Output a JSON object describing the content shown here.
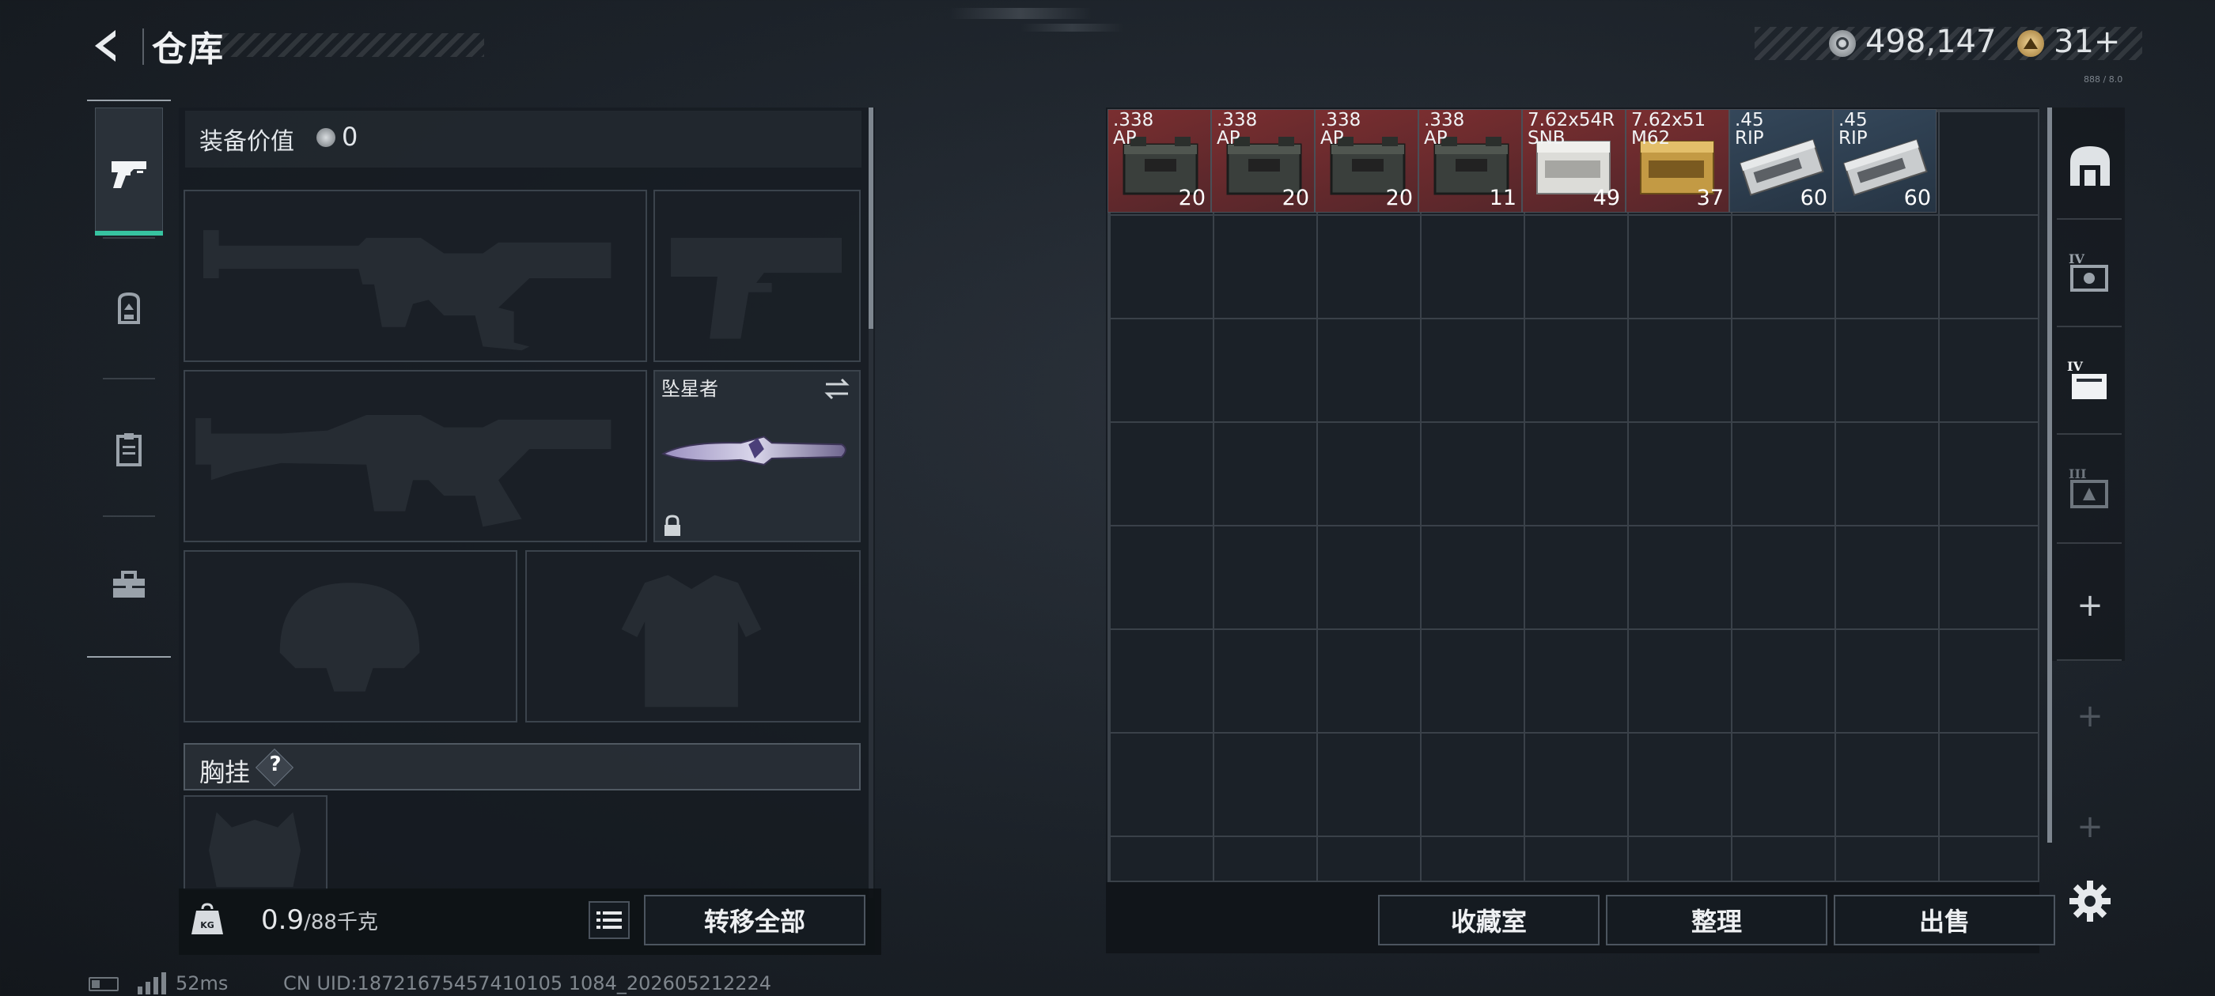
{
  "header": {
    "title": "仓库",
    "currency_primary": "498,147",
    "currency_secondary": "31",
    "currency_secondary_add": "+",
    "version_tag": "888 / 8.0",
    "back_icon": "chevron-left-icon"
  },
  "left_tabs": [
    {
      "name": "weapons",
      "icon": "pistol-icon",
      "active": true
    },
    {
      "name": "backpack",
      "icon": "backpack-icon",
      "active": false
    },
    {
      "name": "clipboard",
      "icon": "clipboard-icon",
      "active": false
    },
    {
      "name": "toolbox",
      "icon": "toolbox-icon",
      "active": false
    }
  ],
  "equipment": {
    "value_label": "装备价值",
    "value": "0",
    "melee_name": "坠星者",
    "chest_rig_label": "胸挂",
    "chest_rig_help": "?",
    "weight_value": "0.9",
    "weight_capacity": "/88千克",
    "kg_badge": "KG",
    "transfer_all_label": "转移全部"
  },
  "storage": {
    "items": [
      {
        "name": ".338\nAP",
        "count": "20",
        "rarity": "red"
      },
      {
        "name": ".338\nAP",
        "count": "20",
        "rarity": "red"
      },
      {
        "name": ".338\nAP",
        "count": "20",
        "rarity": "red"
      },
      {
        "name": ".338\nAP",
        "count": "11",
        "rarity": "red"
      },
      {
        "name": "7.62x54R\nSNB",
        "count": "49",
        "rarity": "red"
      },
      {
        "name": "7.62x51\nM62",
        "count": "37",
        "rarity": "red"
      },
      {
        "name": ".45\nRIP",
        "count": "60",
        "rarity": "blue"
      },
      {
        "name": ".45\nRIP",
        "count": "60",
        "rarity": "blue"
      }
    ],
    "buttons": {
      "collection": "收藏室",
      "sort": "整理",
      "sell": "出售"
    }
  },
  "right_tabs": [
    {
      "icon": "safe-box-icon"
    },
    {
      "icon": "tier-iv-case-icon",
      "label": "IV"
    },
    {
      "icon": "tier-iv-container-icon",
      "label": "IV"
    },
    {
      "icon": "tier-iii-box-icon",
      "label": "III"
    }
  ],
  "status": {
    "ping": "52ms",
    "uid": "CN UID:18721675457410105 1084_202605212224"
  },
  "colors": {
    "accent": "#37c3a0",
    "rarity_red": "#6b2a2c",
    "rarity_blue": "#2a3847"
  }
}
